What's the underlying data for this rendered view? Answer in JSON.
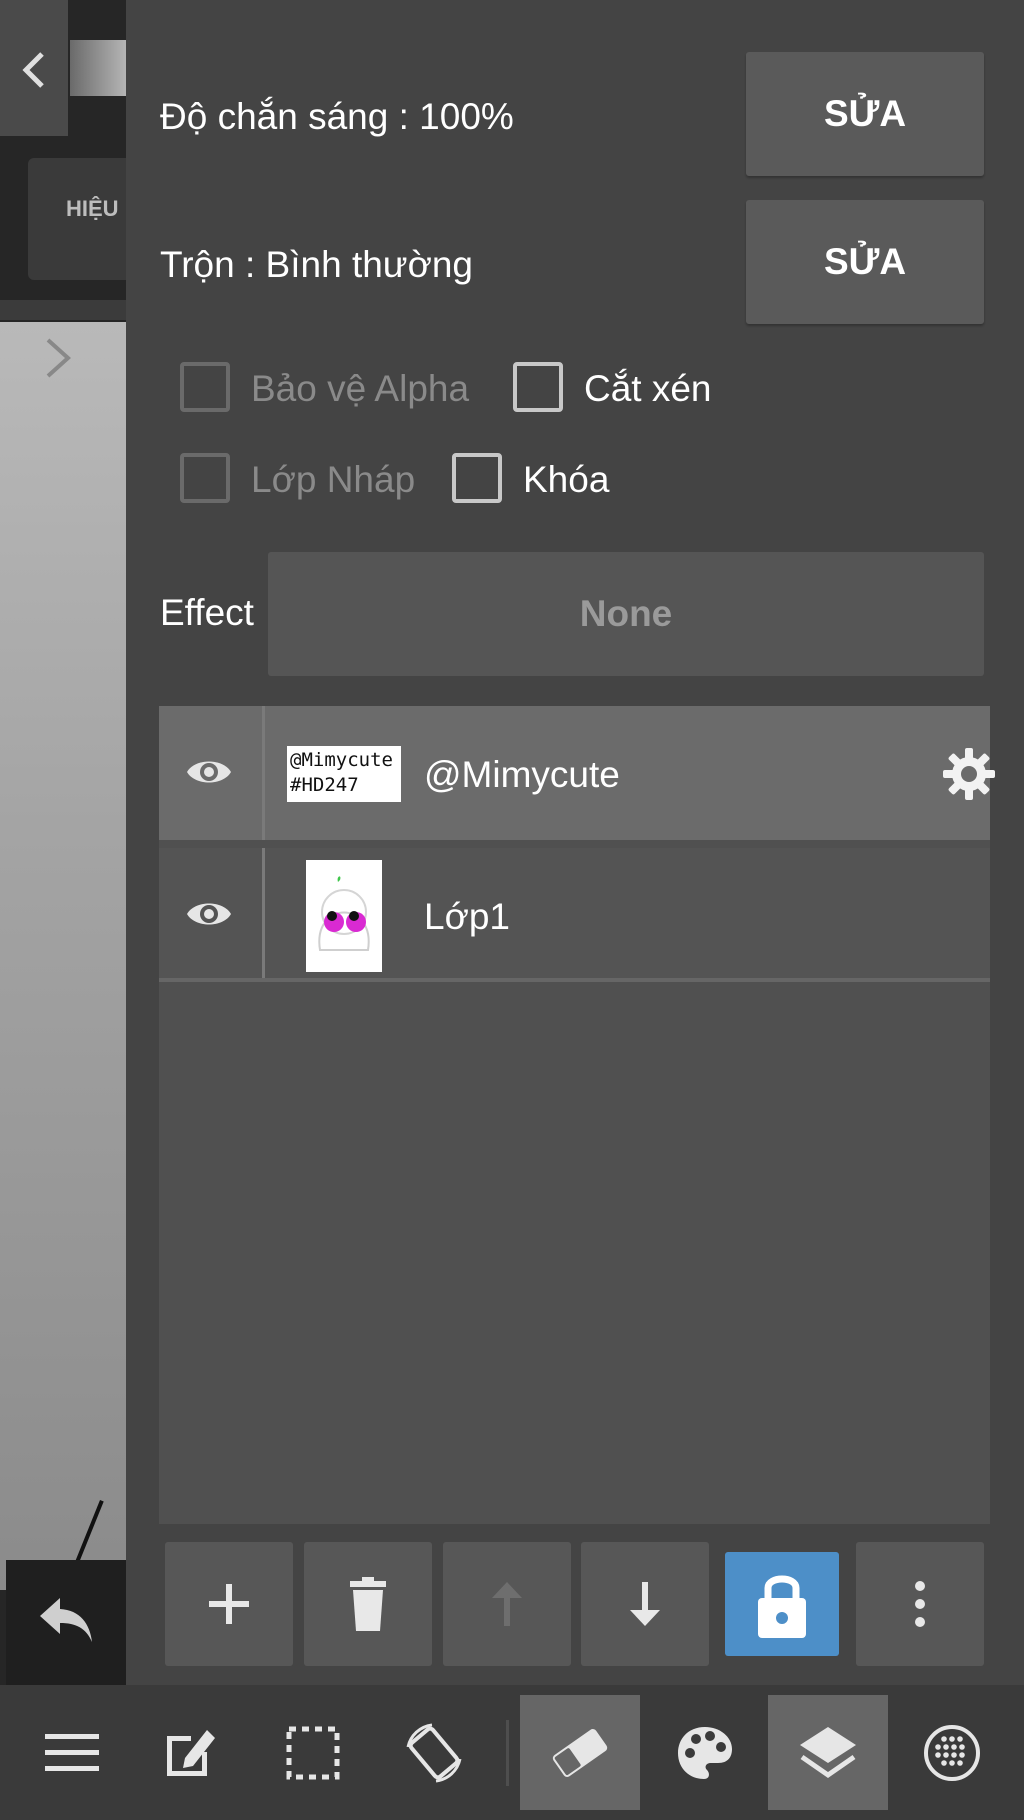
{
  "properties": {
    "opacity_label": "Độ chắn sáng : 100%",
    "blend_label": "Trộn : Bình thường",
    "edit_label": "SỬA"
  },
  "checkboxes": {
    "alpha_protect": "Bảo vệ Alpha",
    "clipping": "Cắt xén",
    "draft_layer": "Lớp Nháp",
    "lock": "Khóa"
  },
  "effect": {
    "label": "Effect",
    "value": "None"
  },
  "layers": [
    {
      "name": "@Mimycute",
      "thumb_text": "@Mimycute #HD247",
      "selected": true
    },
    {
      "name": "Lớp1",
      "selected": false
    }
  ],
  "canvas": {
    "tab_label": "HIỆU"
  },
  "actions": [
    "add-icon",
    "trash-icon",
    "arrow-up-icon",
    "arrow-down-icon",
    "lock-icon",
    "more-icon"
  ],
  "toolbar": [
    "menu-icon",
    "edit-icon",
    "selection-icon",
    "rotate-icon",
    "eraser-icon",
    "palette-icon",
    "layers-icon",
    "dots-grid-icon"
  ],
  "colors": {
    "accent": "#4d8fc8",
    "panel": "#444444",
    "selected_layer": "#6b6b6b"
  }
}
